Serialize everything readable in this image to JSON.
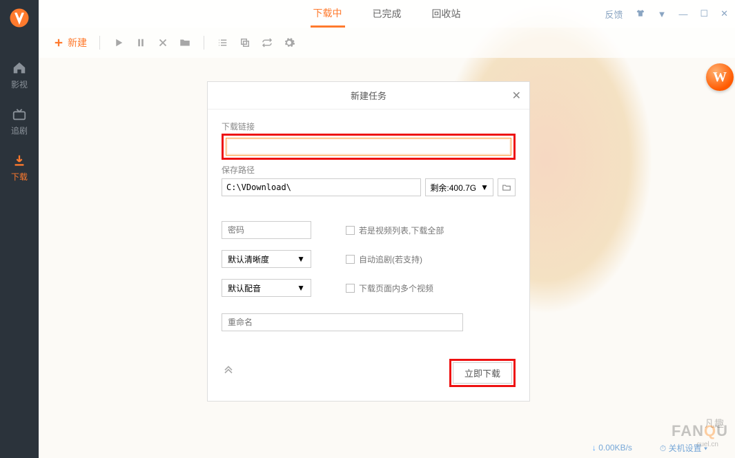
{
  "topbar": {
    "tabs": [
      "下载中",
      "已完成",
      "回收站"
    ],
    "active_tab": 0,
    "feedback": "反馈"
  },
  "sidebar": {
    "items": [
      {
        "label": "影视"
      },
      {
        "label": "追剧"
      },
      {
        "label": "下载"
      }
    ],
    "active": 2
  },
  "toolbar": {
    "new_label": "新建"
  },
  "dialog": {
    "title": "新建任务",
    "link_label": "下载链接",
    "url_value": "",
    "save_label": "保存路径",
    "path_value": "C:\\VDownload\\",
    "remaining": "剩余:400.7G",
    "password_ph": "密码",
    "quality": "默认清晰度",
    "audio": "默认配音",
    "chk_playlist": "若是视频列表,下载全部",
    "chk_follow": "自动追剧(若支持)",
    "chk_multi": "下载页面内多个视频",
    "rename_ph": "重命名",
    "download_btn": "立即下载"
  },
  "status": {
    "speed": "0.00KB/s",
    "settings": "关机设置"
  },
  "watermark": {
    "brand": "FANQU",
    "sub": "cuel.cn",
    "cn": "凡趣"
  }
}
